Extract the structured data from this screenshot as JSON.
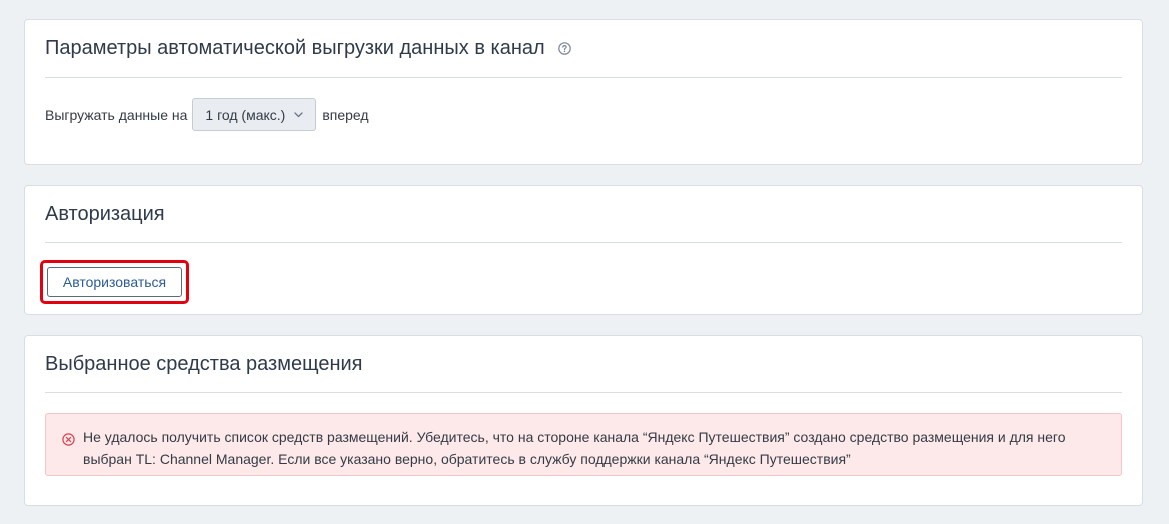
{
  "params_card": {
    "title": "Параметры автоматической выгрузки данных в канал",
    "export_label": "Выгружать данные на",
    "period_select": "1 год (макс.)",
    "suffix": "вперед"
  },
  "auth_card": {
    "title": "Авторизация",
    "button_label": "Авторизоваться"
  },
  "places_card": {
    "title": "Выбранное средства размещения",
    "error_line1": "Не удалось получить список средств размещений. Убедитесь, что на стороне канала “Яндекс Путешествия” создано средство размещения и для него",
    "error_line2": "выбран TL: Channel Manager. Если все указано верно, обратитесь в службу поддержки канала “Яндекс Путешествия”"
  },
  "colors": {
    "background": "#eef1f4",
    "card": "#ffffff",
    "highlight": "#e3000f",
    "alert_bg": "#fde9ea",
    "error_icon": "#d9434e",
    "link_text": "#2b5b93"
  },
  "icons": [
    "help-circle-icon",
    "chevron-down-icon",
    "error-circle-icon"
  ]
}
